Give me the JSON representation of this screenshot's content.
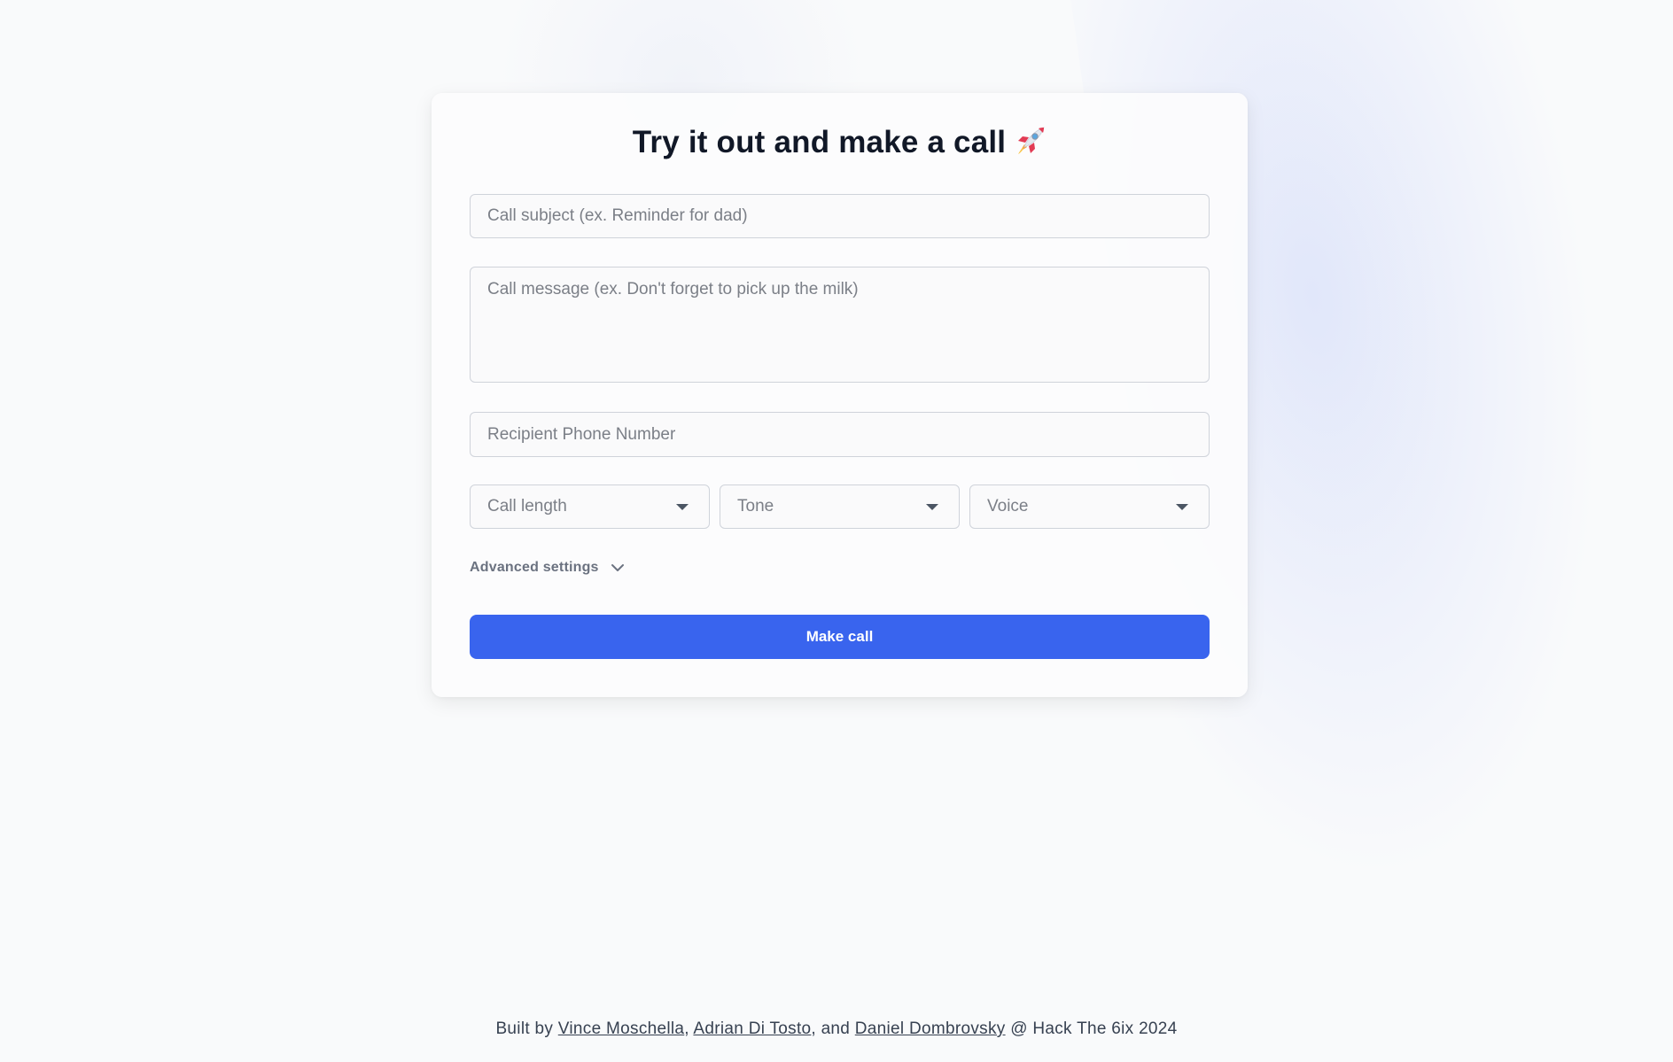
{
  "form": {
    "title": "Try it out and make a call",
    "title_icon": "rocket-icon",
    "subject_placeholder": "Call subject (ex. Reminder for dad)",
    "message_placeholder": "Call message (ex. Don't forget to pick up the milk)",
    "phone_placeholder": "Recipient Phone Number",
    "selects": {
      "length": "Call length",
      "tone": "Tone",
      "voice": "Voice"
    },
    "advanced_label": "Advanced settings",
    "submit_label": "Make call"
  },
  "footer": {
    "prefix": "Built by",
    "author1": "Vince Moschella",
    "sep1": ",",
    "author2": "Adrian Di Tosto",
    "sep2": ", and",
    "author3": "Daniel Dombrovsky",
    "suffix": "@ Hack The 6ix 2024"
  },
  "colors": {
    "accent": "#3964ee",
    "background": "#f9fafb",
    "title_text": "#111827",
    "placeholder_text": "#7b7f87"
  }
}
